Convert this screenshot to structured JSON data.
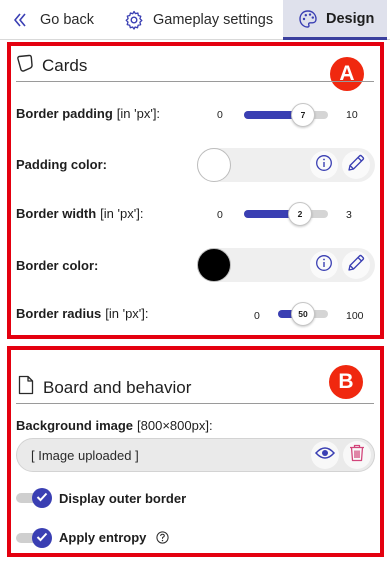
{
  "tabs": {
    "back": "Go back",
    "gameplay": "Gameplay settings",
    "design": "Design"
  },
  "markers": {
    "a": "A",
    "b": "B"
  },
  "cards": {
    "title": "Cards",
    "border_padding": {
      "label": "Border padding",
      "unit": "[in 'px']:",
      "min": "0",
      "max": "10",
      "value": "7"
    },
    "padding_color": {
      "label": "Padding color:",
      "color": "#ffffff"
    },
    "border_width": {
      "label": "Border width",
      "unit": "[in 'px']:",
      "min": "0",
      "max": "3",
      "value": "2"
    },
    "border_color": {
      "label": "Border color:",
      "color": "#000000"
    },
    "border_radius": {
      "label": "Border radius",
      "unit": "[in 'px']:",
      "min": "0",
      "max": "100",
      "value": "50"
    }
  },
  "board": {
    "title": "Board and behavior",
    "background_image": {
      "label": "Background image",
      "unit": "[800×800px]:",
      "value": "[ Image uploaded ]"
    },
    "outer_border": {
      "label": "Display outer border",
      "checked": true
    },
    "entropy": {
      "label": "Apply entropy",
      "checked": true
    }
  },
  "colors": {
    "accent": "#3a3fb3",
    "annotation_red": "#e4000f",
    "delete_pink": "#d2457b"
  },
  "icons": [
    "chevron-left-icon",
    "gear-icon",
    "palette-icon",
    "card-icon",
    "info-icon",
    "pencil-icon",
    "file-icon",
    "eye-icon",
    "trash-icon",
    "check-icon",
    "help-icon"
  ]
}
